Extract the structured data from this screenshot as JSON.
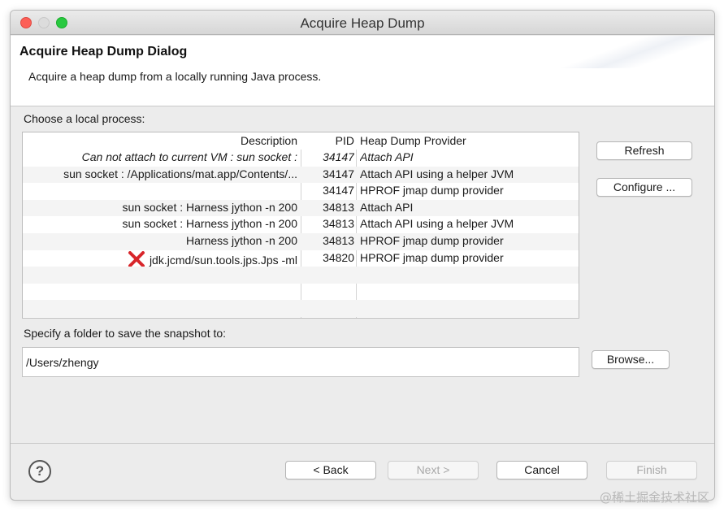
{
  "window": {
    "title": "Acquire Heap Dump"
  },
  "header": {
    "title": "Acquire Heap Dump Dialog",
    "description": "Acquire a heap dump from a locally running Java process."
  },
  "process_section": {
    "label": "Choose a local process:",
    "columns": [
      "Description",
      "PID",
      "Heap Dump Provider"
    ],
    "rows": [
      {
        "description": "Can not attach to current VM : sun socket :",
        "pid": "34147",
        "provider": "Attach API",
        "italic": true,
        "error": false
      },
      {
        "description": "sun socket : /Applications/mat.app/Contents/...",
        "pid": "34147",
        "provider": "Attach API using a helper JVM",
        "italic": false,
        "error": false
      },
      {
        "description": "",
        "pid": "34147",
        "provider": "HPROF jmap dump provider",
        "italic": false,
        "error": false
      },
      {
        "description": "sun socket : Harness jython -n 200",
        "pid": "34813",
        "provider": "Attach API",
        "italic": false,
        "error": false
      },
      {
        "description": "sun socket : Harness jython -n 200",
        "pid": "34813",
        "provider": "Attach API using a helper JVM",
        "italic": false,
        "error": false
      },
      {
        "description": "Harness jython -n 200",
        "pid": "34813",
        "provider": "HPROF jmap dump provider",
        "italic": false,
        "error": false
      },
      {
        "description": "jdk.jcmd/sun.tools.jps.Jps -ml",
        "pid": "34820",
        "provider": "HPROF jmap dump provider",
        "italic": false,
        "error": true
      }
    ],
    "empty_rows": 3,
    "error_icon": "red-x-icon",
    "refresh_label": "Refresh",
    "configure_label": "Configure ..."
  },
  "folder_section": {
    "label": "Specify a folder to save the snapshot to:",
    "value": "/Users/zhengy",
    "browse_label": "Browse..."
  },
  "footer": {
    "help_label": "?",
    "back_label": "< Back",
    "next_label": "Next >",
    "cancel_label": "Cancel",
    "finish_label": "Finish"
  },
  "watermark": "@稀土掘金技术社区",
  "colors": {
    "error_red": "#d8262b",
    "close": "#fc5f57",
    "maximize": "#29c940"
  }
}
